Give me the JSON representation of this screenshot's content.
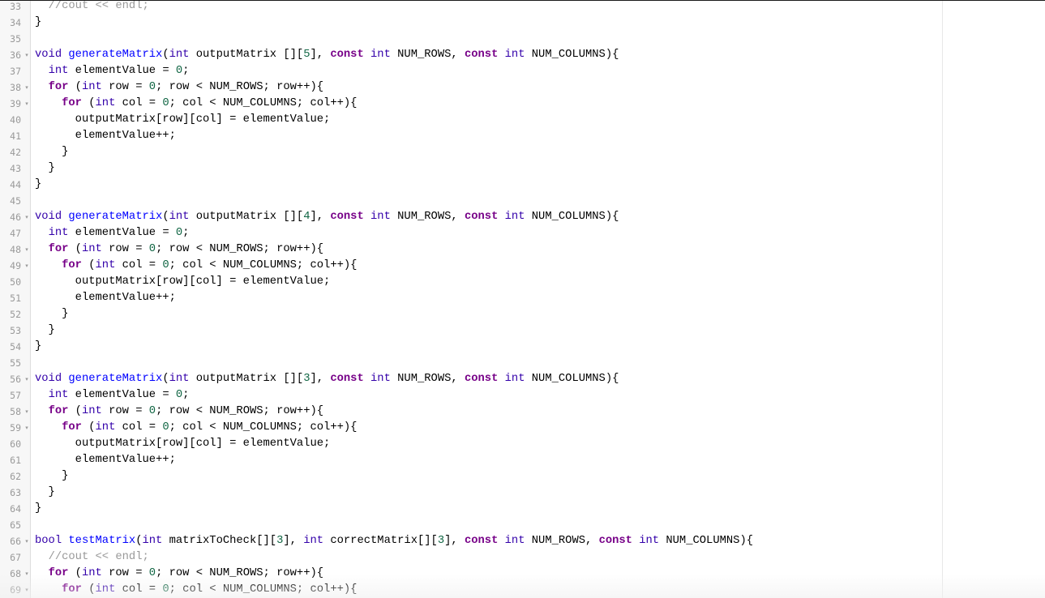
{
  "editor": {
    "fold_marker": "▾",
    "lines": [
      {
        "num": "33",
        "fold": false,
        "tokens": [
          [
            "",
            "  "
          ],
          [
            "cmg",
            "//cout << endl;"
          ]
        ]
      },
      {
        "num": "34",
        "fold": false,
        "tokens": [
          [
            "",
            "}"
          ]
        ]
      },
      {
        "num": "35",
        "fold": false,
        "tokens": []
      },
      {
        "num": "36",
        "fold": true,
        "tokens": [
          [
            "ty",
            "void"
          ],
          [
            "",
            " "
          ],
          [
            "fn",
            "generateMatrix"
          ],
          [
            "",
            "("
          ],
          [
            "ty",
            "int"
          ],
          [
            "",
            " outputMatrix []["
          ],
          [
            "nu",
            "5"
          ],
          [
            "",
            "], "
          ],
          [
            "kw",
            "const"
          ],
          [
            "",
            " "
          ],
          [
            "ty",
            "int"
          ],
          [
            "",
            " NUM_ROWS, "
          ],
          [
            "kw",
            "const"
          ],
          [
            "",
            " "
          ],
          [
            "ty",
            "int"
          ],
          [
            "",
            " NUM_COLUMNS){"
          ]
        ]
      },
      {
        "num": "37",
        "fold": false,
        "tokens": [
          [
            "",
            "  "
          ],
          [
            "ty",
            "int"
          ],
          [
            "",
            " elementValue = "
          ],
          [
            "nu",
            "0"
          ],
          [
            "",
            ";"
          ]
        ]
      },
      {
        "num": "38",
        "fold": true,
        "tokens": [
          [
            "",
            "  "
          ],
          [
            "kw",
            "for"
          ],
          [
            "",
            " ("
          ],
          [
            "ty",
            "int"
          ],
          [
            "",
            " row = "
          ],
          [
            "nu",
            "0"
          ],
          [
            "",
            "; row < NUM_ROWS; row++){"
          ]
        ]
      },
      {
        "num": "39",
        "fold": true,
        "tokens": [
          [
            "",
            "    "
          ],
          [
            "kw",
            "for"
          ],
          [
            "",
            " ("
          ],
          [
            "ty",
            "int"
          ],
          [
            "",
            " col = "
          ],
          [
            "nu",
            "0"
          ],
          [
            "",
            "; col < NUM_COLUMNS; col++){"
          ]
        ]
      },
      {
        "num": "40",
        "fold": false,
        "tokens": [
          [
            "",
            "      outputMatrix[row][col] = elementValue;"
          ]
        ]
      },
      {
        "num": "41",
        "fold": false,
        "tokens": [
          [
            "",
            "      elementValue++;"
          ]
        ]
      },
      {
        "num": "42",
        "fold": false,
        "tokens": [
          [
            "",
            "    }"
          ]
        ]
      },
      {
        "num": "43",
        "fold": false,
        "tokens": [
          [
            "",
            "  }"
          ]
        ]
      },
      {
        "num": "44",
        "fold": false,
        "tokens": [
          [
            "",
            "}"
          ]
        ]
      },
      {
        "num": "45",
        "fold": false,
        "tokens": []
      },
      {
        "num": "46",
        "fold": true,
        "tokens": [
          [
            "ty",
            "void"
          ],
          [
            "",
            " "
          ],
          [
            "fn",
            "generateMatrix"
          ],
          [
            "",
            "("
          ],
          [
            "ty",
            "int"
          ],
          [
            "",
            " outputMatrix []["
          ],
          [
            "nu",
            "4"
          ],
          [
            "",
            "], "
          ],
          [
            "kw",
            "const"
          ],
          [
            "",
            " "
          ],
          [
            "ty",
            "int"
          ],
          [
            "",
            " NUM_ROWS, "
          ],
          [
            "kw",
            "const"
          ],
          [
            "",
            " "
          ],
          [
            "ty",
            "int"
          ],
          [
            "",
            " NUM_COLUMNS){"
          ]
        ]
      },
      {
        "num": "47",
        "fold": false,
        "tokens": [
          [
            "",
            "  "
          ],
          [
            "ty",
            "int"
          ],
          [
            "",
            " elementValue = "
          ],
          [
            "nu",
            "0"
          ],
          [
            "",
            ";"
          ]
        ]
      },
      {
        "num": "48",
        "fold": true,
        "tokens": [
          [
            "",
            "  "
          ],
          [
            "kw",
            "for"
          ],
          [
            "",
            " ("
          ],
          [
            "ty",
            "int"
          ],
          [
            "",
            " row = "
          ],
          [
            "nu",
            "0"
          ],
          [
            "",
            "; row < NUM_ROWS; row++){"
          ]
        ]
      },
      {
        "num": "49",
        "fold": true,
        "tokens": [
          [
            "",
            "    "
          ],
          [
            "kw",
            "for"
          ],
          [
            "",
            " ("
          ],
          [
            "ty",
            "int"
          ],
          [
            "",
            " col = "
          ],
          [
            "nu",
            "0"
          ],
          [
            "",
            "; col < NUM_COLUMNS; col++){"
          ]
        ]
      },
      {
        "num": "50",
        "fold": false,
        "tokens": [
          [
            "",
            "      outputMatrix[row][col] = elementValue;"
          ]
        ]
      },
      {
        "num": "51",
        "fold": false,
        "tokens": [
          [
            "",
            "      elementValue++;"
          ]
        ]
      },
      {
        "num": "52",
        "fold": false,
        "tokens": [
          [
            "",
            "    }"
          ]
        ]
      },
      {
        "num": "53",
        "fold": false,
        "tokens": [
          [
            "",
            "  }"
          ]
        ]
      },
      {
        "num": "54",
        "fold": false,
        "tokens": [
          [
            "",
            "}"
          ]
        ]
      },
      {
        "num": "55",
        "fold": false,
        "tokens": []
      },
      {
        "num": "56",
        "fold": true,
        "tokens": [
          [
            "ty",
            "void"
          ],
          [
            "",
            " "
          ],
          [
            "fn",
            "generateMatrix"
          ],
          [
            "",
            "("
          ],
          [
            "ty",
            "int"
          ],
          [
            "",
            " outputMatrix []["
          ],
          [
            "nu",
            "3"
          ],
          [
            "",
            "], "
          ],
          [
            "kw",
            "const"
          ],
          [
            "",
            " "
          ],
          [
            "ty",
            "int"
          ],
          [
            "",
            " NUM_ROWS, "
          ],
          [
            "kw",
            "const"
          ],
          [
            "",
            " "
          ],
          [
            "ty",
            "int"
          ],
          [
            "",
            " NUM_COLUMNS){"
          ]
        ]
      },
      {
        "num": "57",
        "fold": false,
        "tokens": [
          [
            "",
            "  "
          ],
          [
            "ty",
            "int"
          ],
          [
            "",
            " elementValue = "
          ],
          [
            "nu",
            "0"
          ],
          [
            "",
            ";"
          ]
        ]
      },
      {
        "num": "58",
        "fold": true,
        "tokens": [
          [
            "",
            "  "
          ],
          [
            "kw",
            "for"
          ],
          [
            "",
            " ("
          ],
          [
            "ty",
            "int"
          ],
          [
            "",
            " row = "
          ],
          [
            "nu",
            "0"
          ],
          [
            "",
            "; row < NUM_ROWS; row++){"
          ]
        ]
      },
      {
        "num": "59",
        "fold": true,
        "tokens": [
          [
            "",
            "    "
          ],
          [
            "kw",
            "for"
          ],
          [
            "",
            " ("
          ],
          [
            "ty",
            "int"
          ],
          [
            "",
            " col = "
          ],
          [
            "nu",
            "0"
          ],
          [
            "",
            "; col < NUM_COLUMNS; col++){"
          ]
        ]
      },
      {
        "num": "60",
        "fold": false,
        "tokens": [
          [
            "",
            "      outputMatrix[row][col] = elementValue;"
          ]
        ]
      },
      {
        "num": "61",
        "fold": false,
        "tokens": [
          [
            "",
            "      elementValue++;"
          ]
        ]
      },
      {
        "num": "62",
        "fold": false,
        "tokens": [
          [
            "",
            "    }"
          ]
        ]
      },
      {
        "num": "63",
        "fold": false,
        "tokens": [
          [
            "",
            "  }"
          ]
        ]
      },
      {
        "num": "64",
        "fold": false,
        "tokens": [
          [
            "",
            "}"
          ]
        ]
      },
      {
        "num": "65",
        "fold": false,
        "tokens": []
      },
      {
        "num": "66",
        "fold": true,
        "tokens": [
          [
            "ty",
            "bool"
          ],
          [
            "",
            " "
          ],
          [
            "fn",
            "testMatrix"
          ],
          [
            "",
            "("
          ],
          [
            "ty",
            "int"
          ],
          [
            "",
            " matrixToCheck[]["
          ],
          [
            "nu",
            "3"
          ],
          [
            "",
            "], "
          ],
          [
            "ty",
            "int"
          ],
          [
            "",
            " correctMatrix[]["
          ],
          [
            "nu",
            "3"
          ],
          [
            "",
            "], "
          ],
          [
            "kw",
            "const"
          ],
          [
            "",
            " "
          ],
          [
            "ty",
            "int"
          ],
          [
            "",
            " NUM_ROWS, "
          ],
          [
            "kw",
            "const"
          ],
          [
            "",
            " "
          ],
          [
            "ty",
            "int"
          ],
          [
            "",
            " NUM_COLUMNS){"
          ]
        ]
      },
      {
        "num": "67",
        "fold": false,
        "tokens": [
          [
            "",
            "  "
          ],
          [
            "cmg",
            "//cout << endl;"
          ]
        ]
      },
      {
        "num": "68",
        "fold": true,
        "tokens": [
          [
            "",
            "  "
          ],
          [
            "kw",
            "for"
          ],
          [
            "",
            " ("
          ],
          [
            "ty",
            "int"
          ],
          [
            "",
            " row = "
          ],
          [
            "nu",
            "0"
          ],
          [
            "",
            "; row < NUM_ROWS; row++){"
          ]
        ]
      },
      {
        "num": "69",
        "fold": true,
        "tokens": [
          [
            "",
            "    "
          ],
          [
            "kw",
            "for"
          ],
          [
            "",
            " ("
          ],
          [
            "ty",
            "int"
          ],
          [
            "",
            " col = "
          ],
          [
            "nu",
            "0"
          ],
          [
            "",
            "; col < NUM_COLUMNS; col++){"
          ]
        ]
      }
    ]
  }
}
